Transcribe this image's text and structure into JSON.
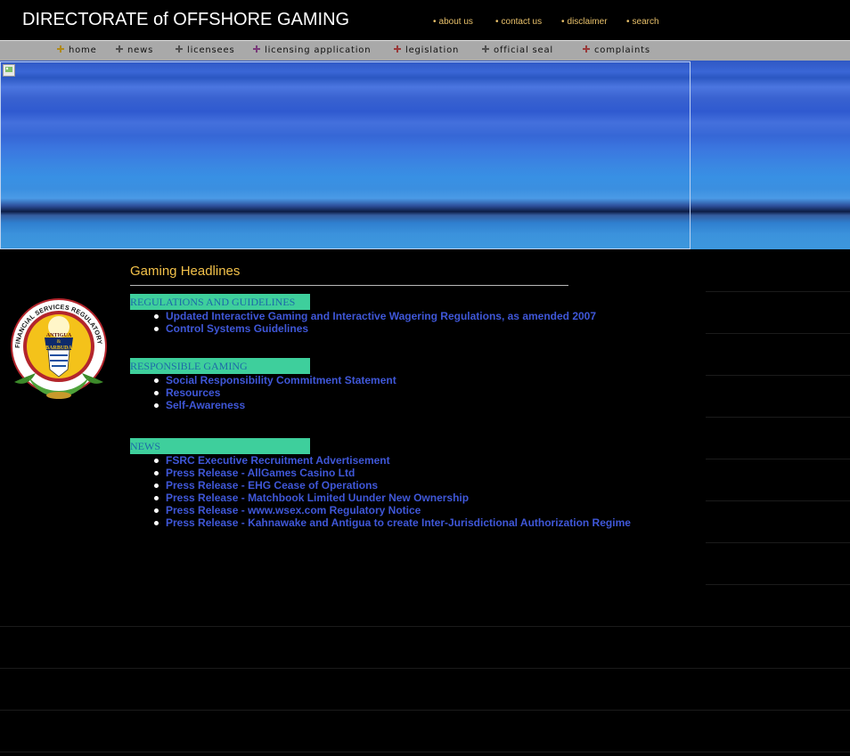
{
  "header": {
    "title": "DIRECTORATE of OFFSHORE GAMING",
    "top_links": [
      {
        "label": "about us"
      },
      {
        "label": "contact us"
      },
      {
        "label": "disclaimer"
      },
      {
        "label": "search"
      }
    ]
  },
  "nav": {
    "items": [
      {
        "label": "home",
        "icon_color": "#b08a1a"
      },
      {
        "label": "news",
        "icon_color": "#505050"
      },
      {
        "label": "licensees",
        "icon_color": "#505050"
      },
      {
        "label": "licensing application",
        "icon_color": "#7a3a7a"
      },
      {
        "label": "legislation",
        "icon_color": "#9a3a3a"
      },
      {
        "label": "official seal",
        "icon_color": "#505050"
      },
      {
        "label": "complaints",
        "icon_color": "#9a3a3a"
      }
    ]
  },
  "seal": {
    "ring_text": "FINANCIAL SERVICES REGULATORY COMMISSION",
    "center_text_1": "ANTIGUA",
    "center_text_2": "&",
    "center_text_3": "BARBUDA"
  },
  "main": {
    "headline": "Gaming Headlines",
    "sections": [
      {
        "heading": "REGULATIONS AND GUIDELINES",
        "links": [
          "Updated Interactive Gaming and Interactive Wagering Regulations, as amended 2007",
          "Control Systems Guidelines"
        ]
      },
      {
        "heading": "RESPONSIBLE GAMING",
        "links": [
          "Social Responsibility Commitment Statement",
          "Resources",
          "Self-Awareness"
        ]
      },
      {
        "heading": "NEWS",
        "links": [
          "FSRC Executive Recruitment Advertisement",
          "Press Release - AllGames Casino Ltd",
          "Press Release - EHG Cease of Operations",
          "Press Release - Matchbook Limited Uunder New Ownership",
          "Press Release - www.wsex.com Regulatory Notice",
          "Press Release - Kahnawake and Antigua to create Inter-Jurisdictional Authorization Regime"
        ]
      }
    ]
  },
  "colors": {
    "headline": "#f2c14a",
    "section_bg": "#3ecf9c",
    "section_text": "#1d6aa8",
    "link": "#3f57d8",
    "top_link": "#e8c06a",
    "nav_bg": "#a9a9a9"
  }
}
